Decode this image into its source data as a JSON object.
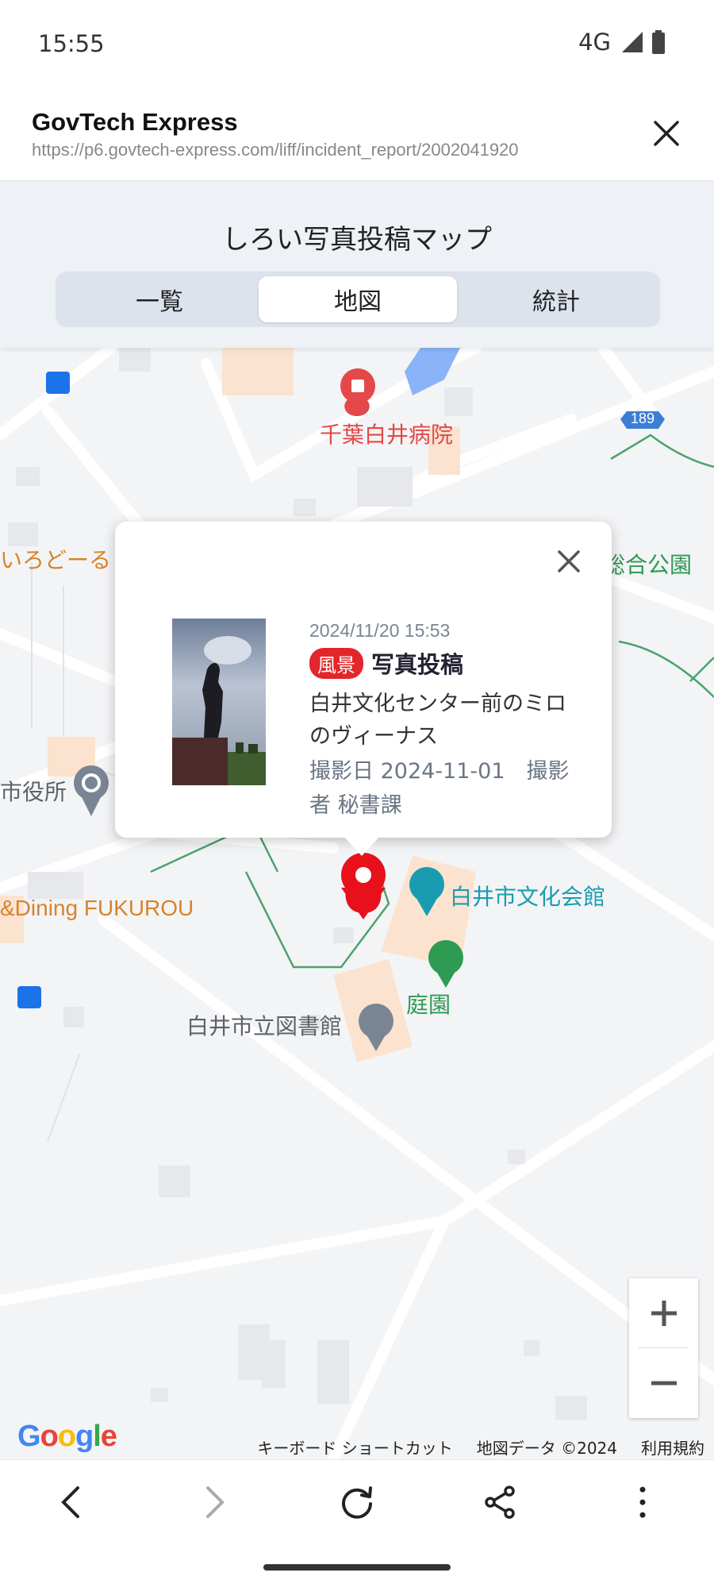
{
  "status_bar": {
    "time": "15:55",
    "network": "4G"
  },
  "browser": {
    "title": "GovTech Express",
    "url": "https://p6.govtech-express.com/liff/incident_report/2002041920"
  },
  "app": {
    "title": "しろい写真投稿マップ",
    "tabs": [
      {
        "label": "一覧",
        "active": false
      },
      {
        "label": "地図",
        "active": true
      },
      {
        "label": "統計",
        "active": false
      }
    ]
  },
  "map": {
    "labels": {
      "hospital": "千葉白井病院",
      "iroad": "いろどーる",
      "park": "総合公園",
      "city_hall": "市役所",
      "restaurant": "&Dining FUKUROU",
      "culture_hall": "白井市文化会館",
      "garden": "庭園",
      "library": "白井市立図書館",
      "route": "189"
    },
    "footer": {
      "shortcuts": "キーボード ショートカット",
      "map_data": "地図データ ©2024",
      "terms": "利用規約"
    },
    "google": "Google"
  },
  "popup": {
    "date": "2024/11/20 15:53",
    "badge": "風景",
    "title": "写真投稿",
    "description": "白井文化センター前のミロのヴィーナス",
    "meta": "撮影日 2024-11-01　撮影者 秘書課"
  },
  "colors": {
    "badge": "#e3262b",
    "pin": "#e8111b",
    "accent_green": "#2e9a52"
  }
}
